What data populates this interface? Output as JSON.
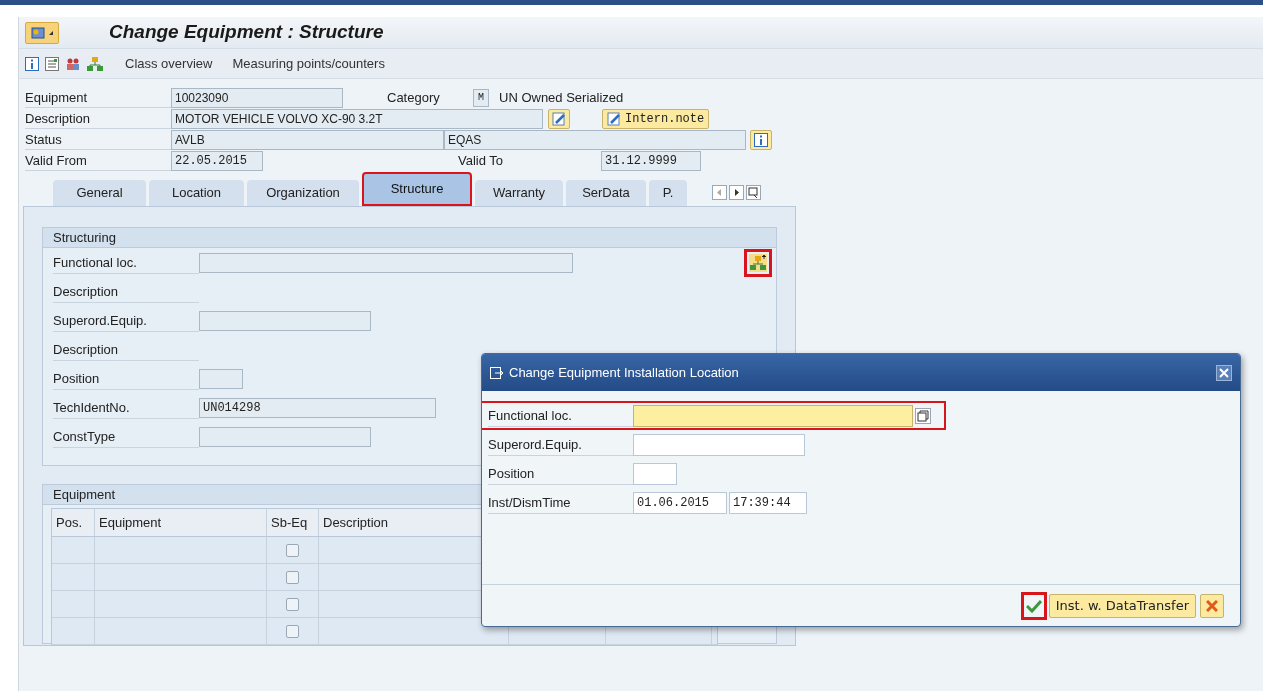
{
  "window": {
    "title": "Change Equipment : Structure"
  },
  "toolbar": {
    "buttons": [
      "Class overview",
      "Measuring points/counters"
    ]
  },
  "header": {
    "equipment": {
      "label": "Equipment",
      "value": "10023090"
    },
    "category": {
      "label": "Category",
      "value": "M",
      "text": "UN Owned Serialized"
    },
    "description": {
      "label": "Description",
      "value": "MOTOR VEHICLE VOLVO XC-90 3.2T",
      "note_button": "Intern.note"
    },
    "status": {
      "label": "Status",
      "value": "AVLB",
      "user_status": "EQAS"
    },
    "valid_from": {
      "label": "Valid From",
      "value": "22.05.2015"
    },
    "valid_to": {
      "label": "Valid To",
      "value": "31.12.9999"
    }
  },
  "tabs": [
    {
      "label": "General",
      "selected": false,
      "highlighted": false
    },
    {
      "label": "Location",
      "selected": false,
      "highlighted": false
    },
    {
      "label": "Organization",
      "selected": false,
      "highlighted": false
    },
    {
      "label": "Structure",
      "selected": true,
      "highlighted": true
    },
    {
      "label": "Warranty",
      "selected": false,
      "highlighted": false
    },
    {
      "label": "SerData",
      "selected": false,
      "highlighted": false
    },
    {
      "label": "P.",
      "selected": false,
      "highlighted": false
    }
  ],
  "structuring": {
    "title": "Structuring",
    "hierarchy_button_highlighted": true,
    "rows": [
      {
        "label": "Functional loc.",
        "kind": "field"
      },
      {
        "label": "Description",
        "kind": "text"
      },
      {
        "label": "Superord.Equip.",
        "kind": "field"
      },
      {
        "label": "Description",
        "kind": "text"
      },
      {
        "label": "Position",
        "kind": "field"
      },
      {
        "label": "TechIdentNo.",
        "kind": "field",
        "value": "UN014298"
      },
      {
        "label": "ConstType",
        "kind": "field"
      }
    ]
  },
  "equipment_table": {
    "title": "Equipment",
    "columns": [
      "Pos.",
      "Equipment",
      "Sb-Eq",
      "Description"
    ],
    "rows": [
      {
        "checked": false
      },
      {
        "checked": false
      },
      {
        "checked": false
      },
      {
        "checked": false
      }
    ]
  },
  "dialog": {
    "title": "Change Equipment Installation Location",
    "rows": [
      {
        "label": "Functional loc.",
        "kind": "focused",
        "highlighted": true
      },
      {
        "label": "Superord.Equip.",
        "kind": "field",
        "highlighted": false
      },
      {
        "label": "Position",
        "kind": "short",
        "highlighted": false
      },
      {
        "label": "Inst/DismTime",
        "kind": "datetime",
        "highlighted": false,
        "values": [
          "01.06.2015",
          "17:39:44"
        ]
      }
    ],
    "confirm_highlighted": true,
    "transfer_button": "Inst. w. DataTransfer"
  }
}
